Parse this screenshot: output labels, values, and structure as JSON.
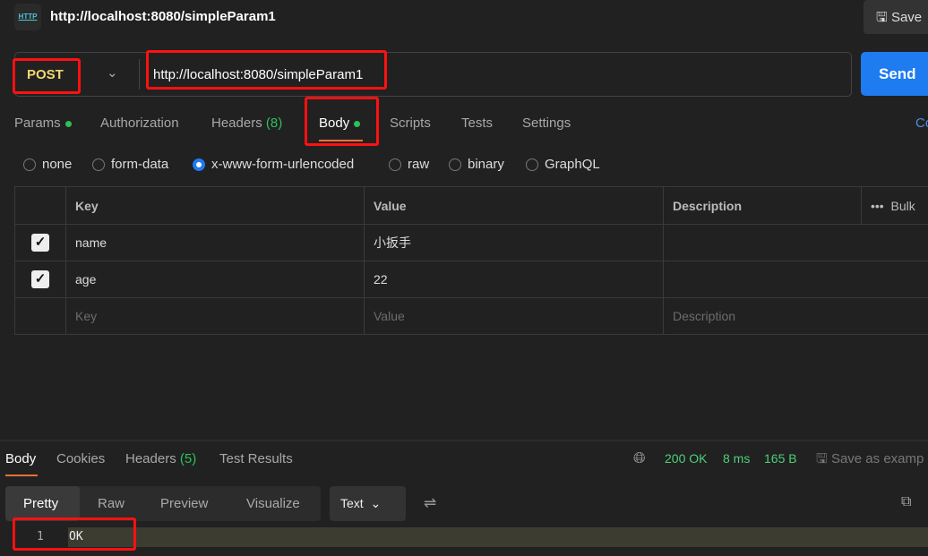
{
  "header": {
    "icon": "http-icon",
    "title": "http://localhost:8080/simpleParam1",
    "save_label": "Save"
  },
  "request": {
    "method": "POST",
    "url": "http://localhost:8080/simpleParam1",
    "send_label": "Send"
  },
  "tabs": [
    {
      "label": "Params"
    },
    {
      "label": "Authorization"
    },
    {
      "label": "Headers",
      "count": "(8)"
    },
    {
      "label": "Body"
    },
    {
      "label": "Scripts"
    },
    {
      "label": "Tests"
    },
    {
      "label": "Settings"
    },
    {
      "label": "Co"
    }
  ],
  "body_types": [
    {
      "label": "none"
    },
    {
      "label": "form-data"
    },
    {
      "label": "x-www-form-urlencoded",
      "selected": true
    },
    {
      "label": "raw"
    },
    {
      "label": "binary"
    },
    {
      "label": "GraphQL"
    }
  ],
  "table": {
    "headers": [
      "Key",
      "Value",
      "Description"
    ],
    "bulk": "Bulk",
    "rows": [
      {
        "key": "name",
        "value": "小扳手",
        "checked": true
      },
      {
        "key": "age",
        "value": "22",
        "checked": true
      }
    ],
    "placeholders": {
      "key": "Key",
      "value": "Value",
      "description": "Description"
    }
  },
  "response": {
    "tabs": [
      {
        "label": "Body"
      },
      {
        "label": "Cookies"
      },
      {
        "label": "Headers",
        "count": "(5)"
      },
      {
        "label": "Test Results"
      }
    ],
    "status": "200 OK",
    "time": "8 ms",
    "size": "165 B",
    "save_example": "Save as examp",
    "views": [
      "Pretty",
      "Raw",
      "Preview",
      "Visualize"
    ],
    "format": "Text",
    "lines": [
      {
        "num": "1",
        "text": "OK"
      }
    ]
  },
  "colors": {
    "accent": "#1e7bf0",
    "method": "#f5d76e",
    "success": "#2fbf5a",
    "highlight": "#f11"
  }
}
